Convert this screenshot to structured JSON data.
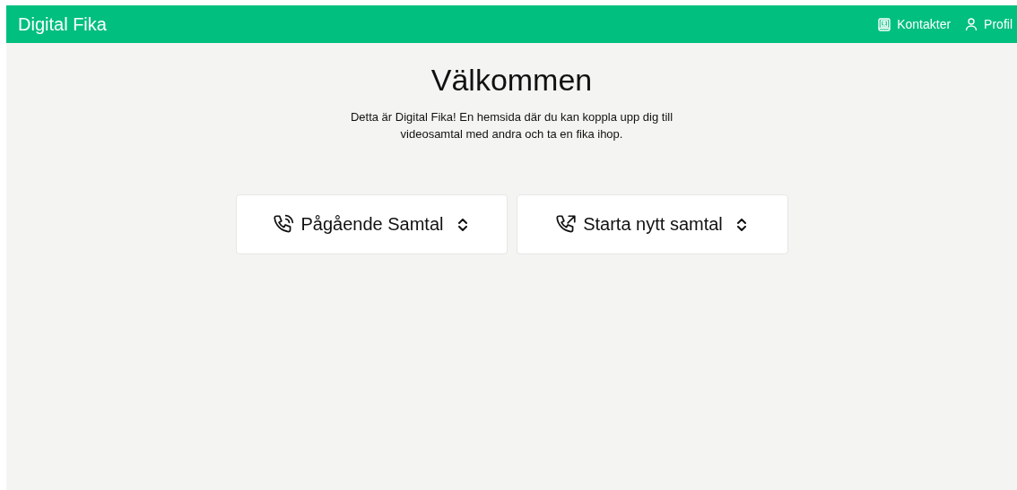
{
  "header": {
    "brand": "Digital Fika",
    "links": [
      {
        "kind": "contacts",
        "label": "Kontakter"
      },
      {
        "kind": "profile",
        "label": "Profil"
      }
    ]
  },
  "title": "Välkommen",
  "intro": "Detta är Digital Fika! En hemsida där du kan koppla upp dig till videosamtal med andra och ta en fika ihop.",
  "actions": [
    {
      "kind": "ongoing",
      "label": "Pågående Samtal",
      "expanded": false
    },
    {
      "kind": "new",
      "label": "Starta nytt samtal",
      "expanded": false
    }
  ]
}
